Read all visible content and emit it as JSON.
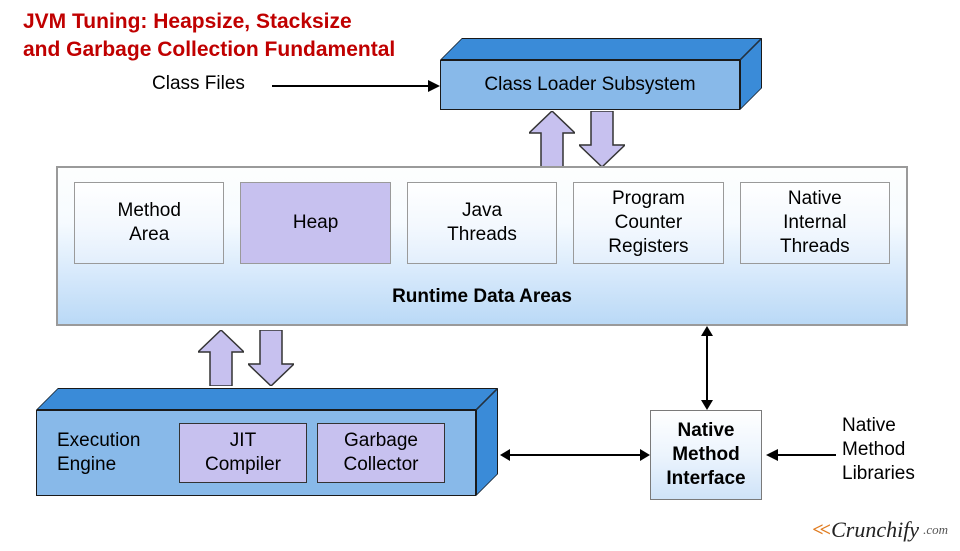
{
  "title": "JVM Tuning: Heapsize, Stacksize\nand Garbage Collection Fundamental",
  "class_files": "Class Files",
  "class_loader": "Class Loader Subsystem",
  "runtime": {
    "title": "Runtime Data Areas",
    "items": [
      "Method\nArea",
      "Heap",
      "Java\nThreads",
      "Program\nCounter\nRegisters",
      "Native\nInternal\nThreads"
    ]
  },
  "exec": {
    "label": "Execution\nEngine",
    "jit": "JIT\nCompiler",
    "gc": "Garbage\nCollector"
  },
  "nmi": "Native\nMethod\nInterface",
  "nml": "Native\nMethod\nLibraries",
  "logo": {
    "brand": "Crunchify",
    "tld": ".com"
  },
  "colors": {
    "title_red": "#c00000",
    "block_face": "#88b9e9",
    "block_depth": "#3a8bd8",
    "purple": "#c7c1ef",
    "logo_orange": "#e07b1f"
  }
}
